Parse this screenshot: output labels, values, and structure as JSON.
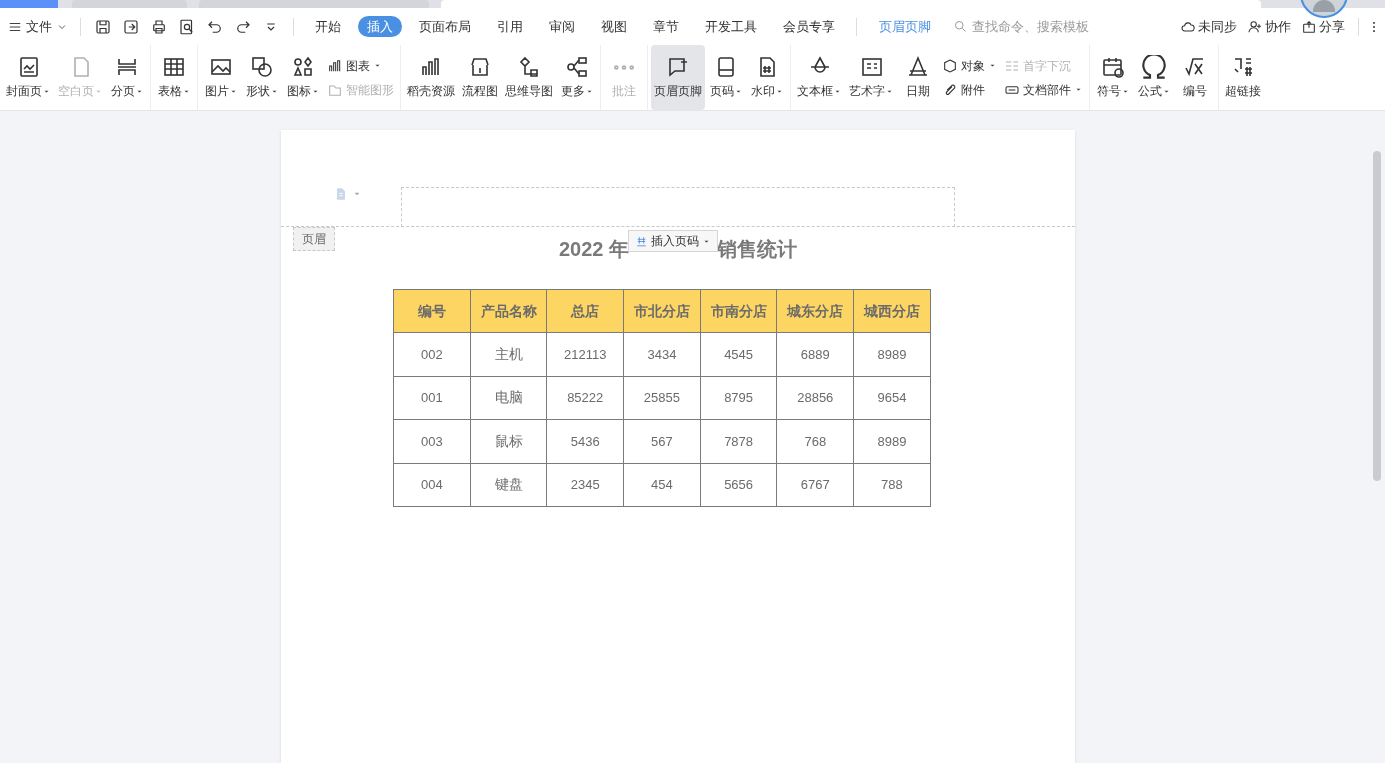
{
  "menu": {
    "file": "文件",
    "tabs": [
      {
        "label": "开始",
        "selected": false
      },
      {
        "label": "插入",
        "selected": true
      },
      {
        "label": "页面布局",
        "selected": false
      },
      {
        "label": "引用",
        "selected": false
      },
      {
        "label": "审阅",
        "selected": false
      },
      {
        "label": "视图",
        "selected": false
      },
      {
        "label": "章节",
        "selected": false
      },
      {
        "label": "开发工具",
        "selected": false
      },
      {
        "label": "会员专享",
        "selected": false
      }
    ],
    "context_tab": "页眉页脚",
    "search": {
      "placeholder": "查找命令、搜索模板"
    },
    "right": [
      "未同步",
      "协作",
      "分享"
    ]
  },
  "ribbon": {
    "groups": [
      [
        {
          "kind": "large",
          "label": "封面页",
          "caret": true,
          "disabled": false,
          "selected": false
        },
        {
          "kind": "large",
          "label": "空白页",
          "caret": true,
          "disabled": true,
          "selected": false
        },
        {
          "kind": "large",
          "label": "分页",
          "caret": true,
          "disabled": false,
          "selected": false
        }
      ],
      [
        {
          "kind": "large",
          "label": "表格",
          "caret": true,
          "disabled": false,
          "selected": false
        }
      ],
      [
        {
          "kind": "large",
          "label": "图片",
          "caret": true,
          "disabled": false,
          "selected": false
        },
        {
          "kind": "large",
          "label": "形状",
          "caret": true,
          "disabled": false,
          "selected": false
        },
        {
          "kind": "large",
          "label": "图标",
          "caret": true,
          "disabled": false,
          "selected": false
        },
        {
          "kind": "pair",
          "items": [
            {
              "label": "图表",
              "caret": true,
              "disabled": false
            },
            {
              "label": "智能图形",
              "caret": false,
              "disabled": true
            }
          ]
        }
      ],
      [
        {
          "kind": "large",
          "label": "稻壳资源",
          "caret": false,
          "disabled": false,
          "selected": false
        },
        {
          "kind": "large",
          "label": "流程图",
          "caret": false,
          "disabled": false,
          "selected": false
        },
        {
          "kind": "large",
          "label": "思维导图",
          "caret": false,
          "disabled": false,
          "selected": false
        },
        {
          "kind": "large",
          "label": "更多",
          "caret": true,
          "disabled": false,
          "selected": false
        }
      ],
      [
        {
          "kind": "large",
          "label": "批注",
          "caret": false,
          "disabled": true,
          "selected": false
        }
      ],
      [
        {
          "kind": "large",
          "label": "页眉页脚",
          "caret": false,
          "disabled": false,
          "selected": true
        },
        {
          "kind": "large",
          "label": "页码",
          "caret": true,
          "disabled": false,
          "selected": false
        },
        {
          "kind": "large",
          "label": "水印",
          "caret": true,
          "disabled": false,
          "selected": false
        }
      ],
      [
        {
          "kind": "large",
          "label": "文本框",
          "caret": true,
          "disabled": false,
          "selected": false
        },
        {
          "kind": "large",
          "label": "艺术字",
          "caret": true,
          "disabled": false,
          "selected": false
        },
        {
          "kind": "large",
          "label": "日期",
          "caret": false,
          "disabled": false,
          "selected": false
        },
        {
          "kind": "pair",
          "items": [
            {
              "label": "对象",
              "caret": true,
              "disabled": false
            },
            {
              "label": "附件",
              "caret": false,
              "disabled": false
            }
          ]
        },
        {
          "kind": "pair",
          "items": [
            {
              "label": "首字下沉",
              "caret": false,
              "disabled": true
            },
            {
              "label": "文档部件",
              "caret": true,
              "disabled": false
            }
          ]
        }
      ],
      [
        {
          "kind": "large",
          "label": "符号",
          "caret": true,
          "disabled": false,
          "selected": false
        },
        {
          "kind": "large",
          "label": "公式",
          "caret": true,
          "disabled": false,
          "selected": false
        },
        {
          "kind": "large",
          "label": "编号",
          "caret": false,
          "disabled": false,
          "selected": false
        }
      ],
      [
        {
          "kind": "large",
          "label": "超链接",
          "caret": false,
          "disabled": false,
          "selected": false
        }
      ]
    ]
  },
  "document": {
    "header_label": "页眉",
    "insert_page_number": "插入页码",
    "title_left": "2022 年",
    "title_right": "销售统计",
    "table": {
      "columns": [
        "编号",
        "产品名称",
        "总店",
        "市北分店",
        "市南分店",
        "城东分店",
        "城西分店"
      ],
      "rows": [
        [
          "002",
          "主机",
          "212113",
          "3434",
          "4545",
          "6889",
          "8989"
        ],
        [
          "001",
          "电脑",
          "85222",
          "25855",
          "8795",
          "28856",
          "9654"
        ],
        [
          "003",
          "鼠标",
          "5436",
          "567",
          "7878",
          "768",
          "8989"
        ],
        [
          "004",
          "键盘",
          "2345",
          "454",
          "5656",
          "6767",
          "788"
        ]
      ]
    }
  }
}
